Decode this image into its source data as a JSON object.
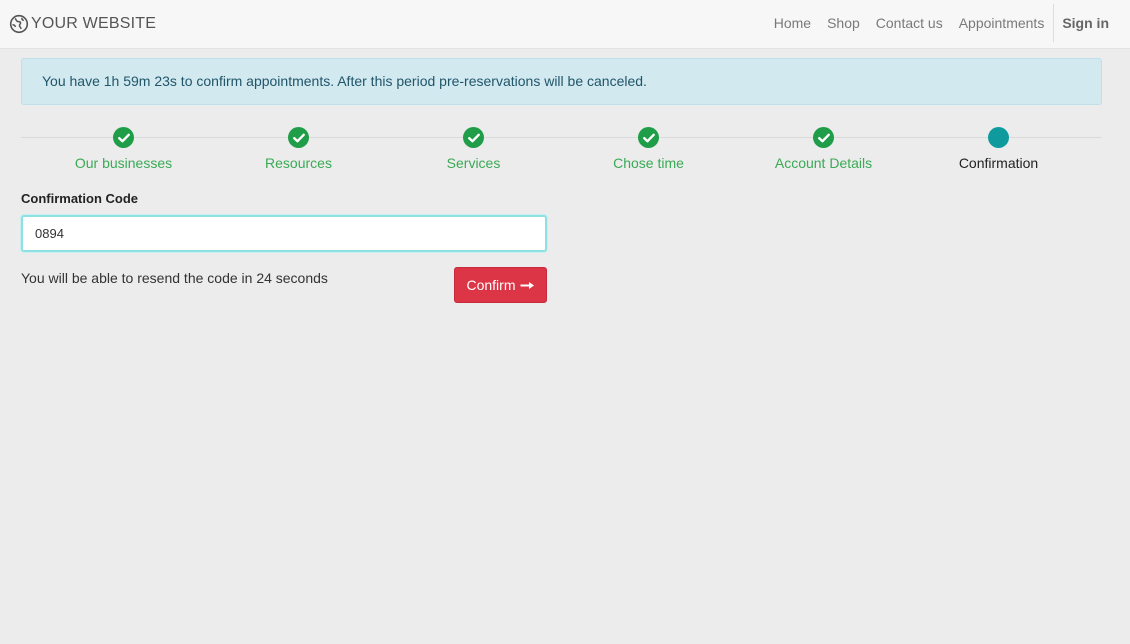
{
  "brand": {
    "name": "YOUR WEBSITE",
    "icon": "globe-icon"
  },
  "nav": {
    "links": [
      "Home",
      "Shop",
      "Contact us",
      "Appointments"
    ],
    "sign_in": "Sign in"
  },
  "alert": {
    "text": "You have 1h 59m 23s to confirm appointments. After this period pre-reservations will be canceled."
  },
  "steps": [
    {
      "label": "Our businesses",
      "status": "done",
      "icon": "check-icon"
    },
    {
      "label": "Resources",
      "status": "done",
      "icon": "check-icon"
    },
    {
      "label": "Services",
      "status": "done",
      "icon": "check-icon"
    },
    {
      "label": "Chose time",
      "status": "done",
      "icon": "check-icon"
    },
    {
      "label": "Account Details",
      "status": "done",
      "icon": "check-icon"
    },
    {
      "label": "Confirmation",
      "status": "current",
      "icon": "dot-icon"
    }
  ],
  "form": {
    "code_label": "Confirmation Code",
    "code_value": "0894",
    "resend_text": "You will be able to resend the code in 24 seconds",
    "confirm_label": "Confirm",
    "confirm_icon": "arrow-right-icon"
  },
  "colors": {
    "done": "#1f9d48",
    "current": "#0f9b9e",
    "confirm_button": "#dc3545",
    "alert_bg": "#d1e9ef"
  }
}
